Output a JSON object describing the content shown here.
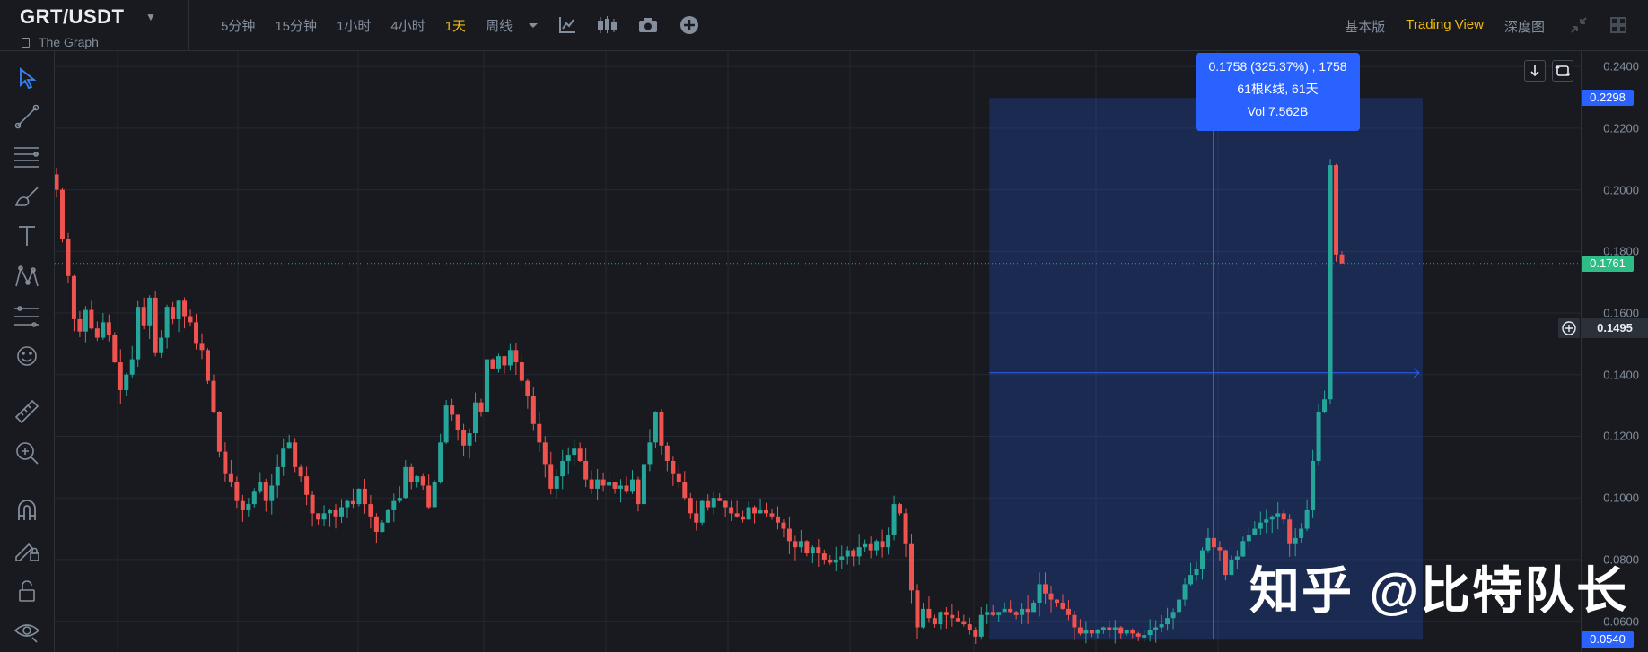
{
  "header": {
    "symbol": "GRT/USDT",
    "subtitle": "The Graph",
    "intervals": [
      "5分钟",
      "15分钟",
      "1小时",
      "4小时",
      "1天",
      "周线"
    ],
    "active_interval": "1天",
    "views": [
      "基本版",
      "Trading View",
      "深度图"
    ],
    "active_view": "Trading View"
  },
  "icons": {
    "toolbar": [
      "caret-down-icon",
      "indicator-icon",
      "candle-style-icon",
      "camera-icon",
      "add-icon"
    ],
    "right": [
      "collapse-icon",
      "grid-icon"
    ],
    "left": [
      "cursor-icon",
      "trend-line-icon",
      "horizontal-lines-icon",
      "brush-icon",
      "text-icon",
      "pattern-icon",
      "fib-icon",
      "emoji-icon",
      "ruler-icon",
      "zoom-in-icon",
      "magnet-icon",
      "lock-drawing-icon",
      "lock-icon",
      "eye-icon"
    ]
  },
  "colors": {
    "up": "#26a69a",
    "down": "#ef5350",
    "accent": "#f0b90b",
    "selection": "#2962ff"
  },
  "measure": {
    "line1": "0.1758 (325.37%) , 1758",
    "line2": "61根K线, 61天",
    "line3": "Vol 7.562B",
    "top_price": "0.2298",
    "bottom_price": "0.0540"
  },
  "last_price_label": "0.1761",
  "crosshair_price": "0.1495",
  "watermark": "知乎 @比特队长",
  "chart_data": {
    "type": "candlestick",
    "title": "",
    "ylim": [
      0.05,
      0.245
    ],
    "yticks": [
      "0.2400",
      "0.2200",
      "0.2000",
      "0.1800",
      "0.1600",
      "0.1400",
      "0.1200",
      "0.1000",
      "0.0800",
      "0.0600"
    ],
    "last_price": 0.1761,
    "measure_range": [
      0.054,
      0.2298
    ],
    "close": [
      0.2,
      0.184,
      0.172,
      0.158,
      0.154,
      0.161,
      0.155,
      0.152,
      0.157,
      0.153,
      0.144,
      0.135,
      0.14,
      0.145,
      0.162,
      0.156,
      0.165,
      0.147,
      0.152,
      0.162,
      0.158,
      0.164,
      0.159,
      0.157,
      0.15,
      0.148,
      0.138,
      0.128,
      0.115,
      0.108,
      0.105,
      0.099,
      0.096,
      0.098,
      0.102,
      0.105,
      0.099,
      0.104,
      0.11,
      0.116,
      0.118,
      0.11,
      0.107,
      0.101,
      0.095,
      0.093,
      0.095,
      0.096,
      0.094,
      0.097,
      0.099,
      0.098,
      0.103,
      0.098,
      0.094,
      0.089,
      0.092,
      0.096,
      0.099,
      0.1,
      0.11,
      0.105,
      0.107,
      0.104,
      0.097,
      0.105,
      0.118,
      0.13,
      0.127,
      0.122,
      0.117,
      0.121,
      0.131,
      0.128,
      0.145,
      0.142,
      0.146,
      0.143,
      0.148,
      0.144,
      0.138,
      0.133,
      0.124,
      0.118,
      0.111,
      0.103,
      0.107,
      0.112,
      0.114,
      0.116,
      0.112,
      0.106,
      0.103,
      0.106,
      0.104,
      0.105,
      0.103,
      0.104,
      0.102,
      0.106,
      0.098,
      0.111,
      0.118,
      0.128,
      0.117,
      0.112,
      0.108,
      0.105,
      0.1,
      0.095,
      0.092,
      0.099,
      0.097,
      0.1,
      0.099,
      0.097,
      0.095,
      0.094,
      0.093,
      0.097,
      0.095,
      0.096,
      0.095,
      0.094,
      0.092,
      0.09,
      0.086,
      0.084,
      0.086,
      0.082,
      0.084,
      0.082,
      0.08,
      0.079,
      0.08,
      0.081,
      0.083,
      0.081,
      0.084,
      0.085,
      0.083,
      0.086,
      0.084,
      0.088,
      0.098,
      0.095,
      0.085,
      0.07,
      0.058,
      0.064,
      0.061,
      0.059,
      0.063,
      0.062,
      0.061,
      0.06,
      0.059,
      0.057,
      0.055,
      0.062,
      0.063,
      0.062,
      0.063,
      0.064,
      0.063,
      0.062,
      0.064,
      0.063,
      0.066,
      0.072,
      0.069,
      0.067,
      0.066,
      0.064,
      0.062,
      0.058,
      0.056,
      0.057,
      0.056,
      0.057,
      0.058,
      0.057,
      0.058,
      0.056,
      0.057,
      0.056,
      0.055,
      0.0555,
      0.057,
      0.058,
      0.059,
      0.061,
      0.063,
      0.067,
      0.072,
      0.075,
      0.077,
      0.083,
      0.087,
      0.084,
      0.083,
      0.075,
      0.08,
      0.081,
      0.086,
      0.088,
      0.09,
      0.092,
      0.093,
      0.094,
      0.095,
      0.093,
      0.085,
      0.087,
      0.09,
      0.096,
      0.112,
      0.128,
      0.132,
      0.208,
      0.179,
      0.1761
    ]
  }
}
